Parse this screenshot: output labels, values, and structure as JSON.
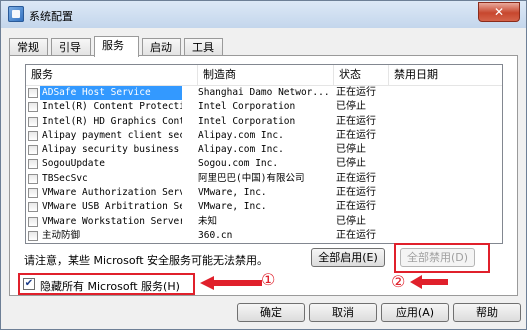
{
  "window": {
    "title": "系统配置",
    "close_label": "✕"
  },
  "tabs": [
    {
      "label": "常规"
    },
    {
      "label": "引导"
    },
    {
      "label": "服务"
    },
    {
      "label": "启动"
    },
    {
      "label": "工具"
    }
  ],
  "services": {
    "columns": [
      "服务",
      "制造商",
      "状态",
      "禁用日期"
    ],
    "rows": [
      {
        "name": "ADSafe Host Service",
        "maker": "Shanghai Damo Networ...",
        "status": "正在运行",
        "selected": true
      },
      {
        "name": "Intel(R) Content Protecti...",
        "maker": "Intel Corporation",
        "status": "已停止"
      },
      {
        "name": "Intel(R) HD Graphics Cont...",
        "maker": "Intel Corporation",
        "status": "正在运行"
      },
      {
        "name": "Alipay payment client sec...",
        "maker": "Alipay.com Inc.",
        "status": "正在运行"
      },
      {
        "name": "Alipay security business ...",
        "maker": "Alipay.com Inc.",
        "status": "已停止"
      },
      {
        "name": "SogouUpdate",
        "maker": "Sogou.com Inc.",
        "status": "已停止"
      },
      {
        "name": "TBSecSvc",
        "maker": "阿里巴巴(中国)有限公司",
        "status": "正在运行"
      },
      {
        "name": "VMware Authorization Service",
        "maker": "VMware, Inc.",
        "status": "正在运行"
      },
      {
        "name": "VMware USB Arbitration Ser...",
        "maker": "VMware, Inc.",
        "status": "正在运行"
      },
      {
        "name": "VMware Workstation Server",
        "maker": "未知",
        "status": "已停止"
      },
      {
        "name": "主动防御",
        "maker": "360.cn",
        "status": "正在运行"
      }
    ]
  },
  "note": "请注意，某些 Microsoft 安全服务可能无法禁用。",
  "buttons": {
    "enable_all": "全部启用(E)",
    "disable_all": "全部禁用(D)",
    "ok": "确定",
    "cancel": "取消",
    "apply": "应用(A)",
    "help": "帮助"
  },
  "hide_ms": {
    "label": "隐藏所有 Microsoft 服务(H)",
    "checked": true,
    "check_mark": "✔"
  },
  "annotations": {
    "one": "①",
    "two": "②",
    "color": "#e0202b"
  }
}
